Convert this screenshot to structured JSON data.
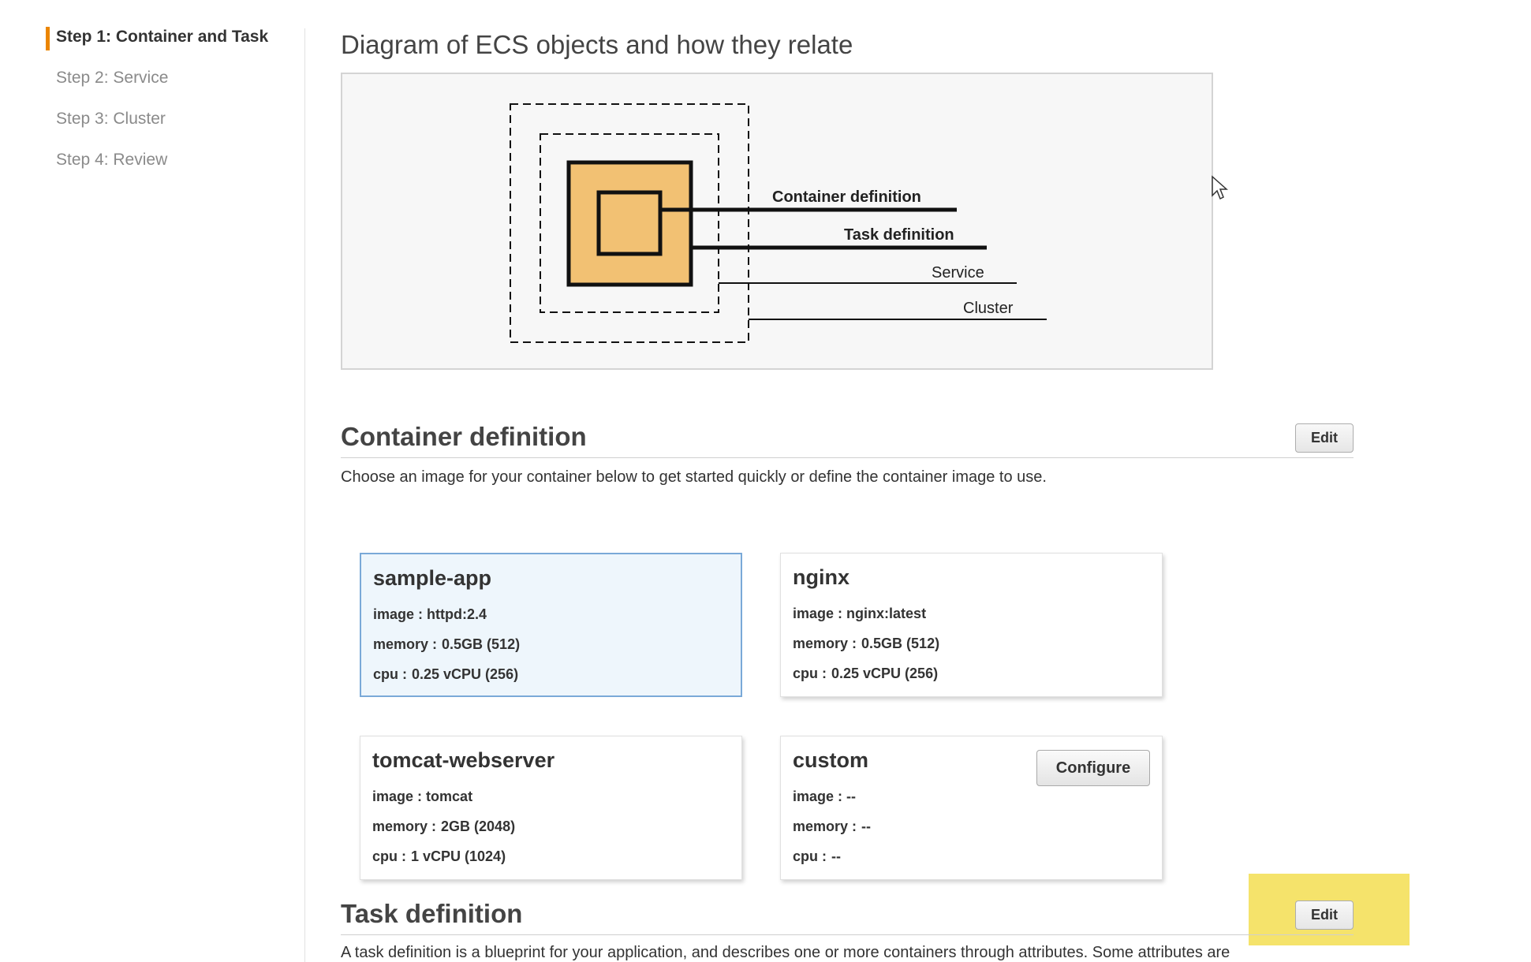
{
  "sidebar": {
    "steps": [
      {
        "label": "Step 1: Container and Task"
      },
      {
        "label": "Step 2: Service"
      },
      {
        "label": "Step 3: Cluster"
      },
      {
        "label": "Step 4: Review"
      }
    ],
    "active_index": 0,
    "accent_color": "#eb8500"
  },
  "diagram": {
    "heading": "Diagram of ECS objects and how they relate",
    "labels": {
      "container_definition": "Container definition",
      "task_definition": "Task definition",
      "service": "Service",
      "cluster": "Cluster"
    },
    "fill_color": "#f2c173"
  },
  "container_section": {
    "title": "Container definition",
    "edit_label": "Edit",
    "description": "Choose an image for your container below to get started quickly or define the container image to use.",
    "cards": [
      {
        "name": "sample-app",
        "image_label": "image :",
        "image": "httpd:2.4",
        "memory_label": "memory :",
        "memory": "0.5GB (512)",
        "cpu_label": "cpu :",
        "cpu": "0.25 vCPU (256)",
        "selected": true
      },
      {
        "name": "nginx",
        "image_label": "image :",
        "image": "nginx:latest",
        "memory_label": "memory :",
        "memory": "0.5GB (512)",
        "cpu_label": "cpu :",
        "cpu": "0.25 vCPU (256)",
        "selected": false
      },
      {
        "name": "tomcat-webserver",
        "image_label": "image :",
        "image": "tomcat",
        "memory_label": "memory :",
        "memory": "2GB (2048)",
        "cpu_label": "cpu :",
        "cpu": "1 vCPU (1024)",
        "selected": false
      },
      {
        "name": "custom",
        "image_label": "image :",
        "image": "--",
        "memory_label": "memory :",
        "memory": "--",
        "cpu_label": "cpu :",
        "cpu": "--",
        "selected": false,
        "configure_label": "Configure"
      }
    ]
  },
  "task_section": {
    "title": "Task definition",
    "edit_label": "Edit",
    "description": "A task definition is a blueprint for your application, and describes one or more containers through attributes. Some attributes are",
    "highlight_color": "#f5e36b"
  }
}
